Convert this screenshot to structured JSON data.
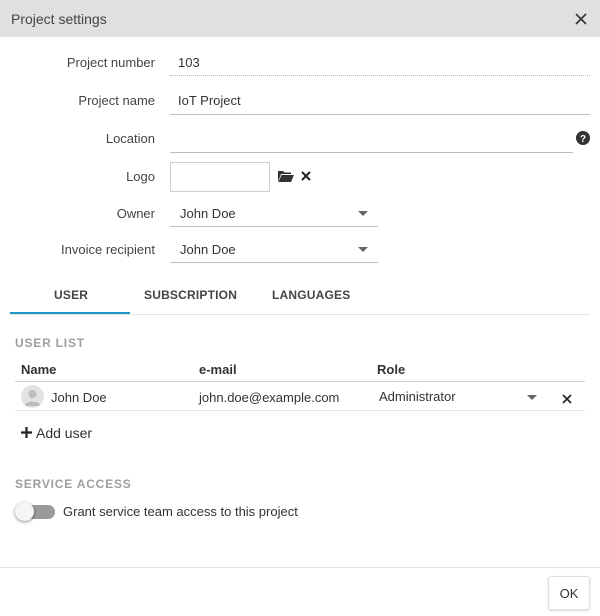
{
  "dialog": {
    "title": "Project settings",
    "close_icon": "close-icon"
  },
  "form": {
    "project_number": {
      "label": "Project number",
      "value": "103"
    },
    "project_name": {
      "label": "Project name",
      "value": "IoT Project"
    },
    "location": {
      "label": "Location",
      "value": "",
      "help_icon": "help-icon"
    },
    "logo": {
      "label": "Logo",
      "browse_icon": "folder-open-icon",
      "clear_icon": "close-icon"
    },
    "owner": {
      "label": "Owner",
      "value": "John Doe"
    },
    "invoice_recipient": {
      "label": "Invoice recipient",
      "value": "John Doe"
    }
  },
  "tabs": [
    {
      "label": "USER",
      "active": true
    },
    {
      "label": "SUBSCRIPTION",
      "active": false
    },
    {
      "label": "LANGUAGES",
      "active": false
    }
  ],
  "user_list": {
    "title": "USER LIST",
    "columns": [
      "Name",
      "e-mail",
      "Role"
    ],
    "rows": [
      {
        "name": "John Doe",
        "email": "john.doe@example.com",
        "role": "Administrator"
      }
    ],
    "add_label": "Add user"
  },
  "service_access": {
    "title": "SERVICE ACCESS",
    "toggle_label": "Grant service team access to this project",
    "enabled": false
  },
  "footer": {
    "ok_label": "OK"
  },
  "colors": {
    "accent": "#2196c9",
    "titlebar": "#e0e0e0",
    "toggle_off": "#9a9a9a"
  }
}
